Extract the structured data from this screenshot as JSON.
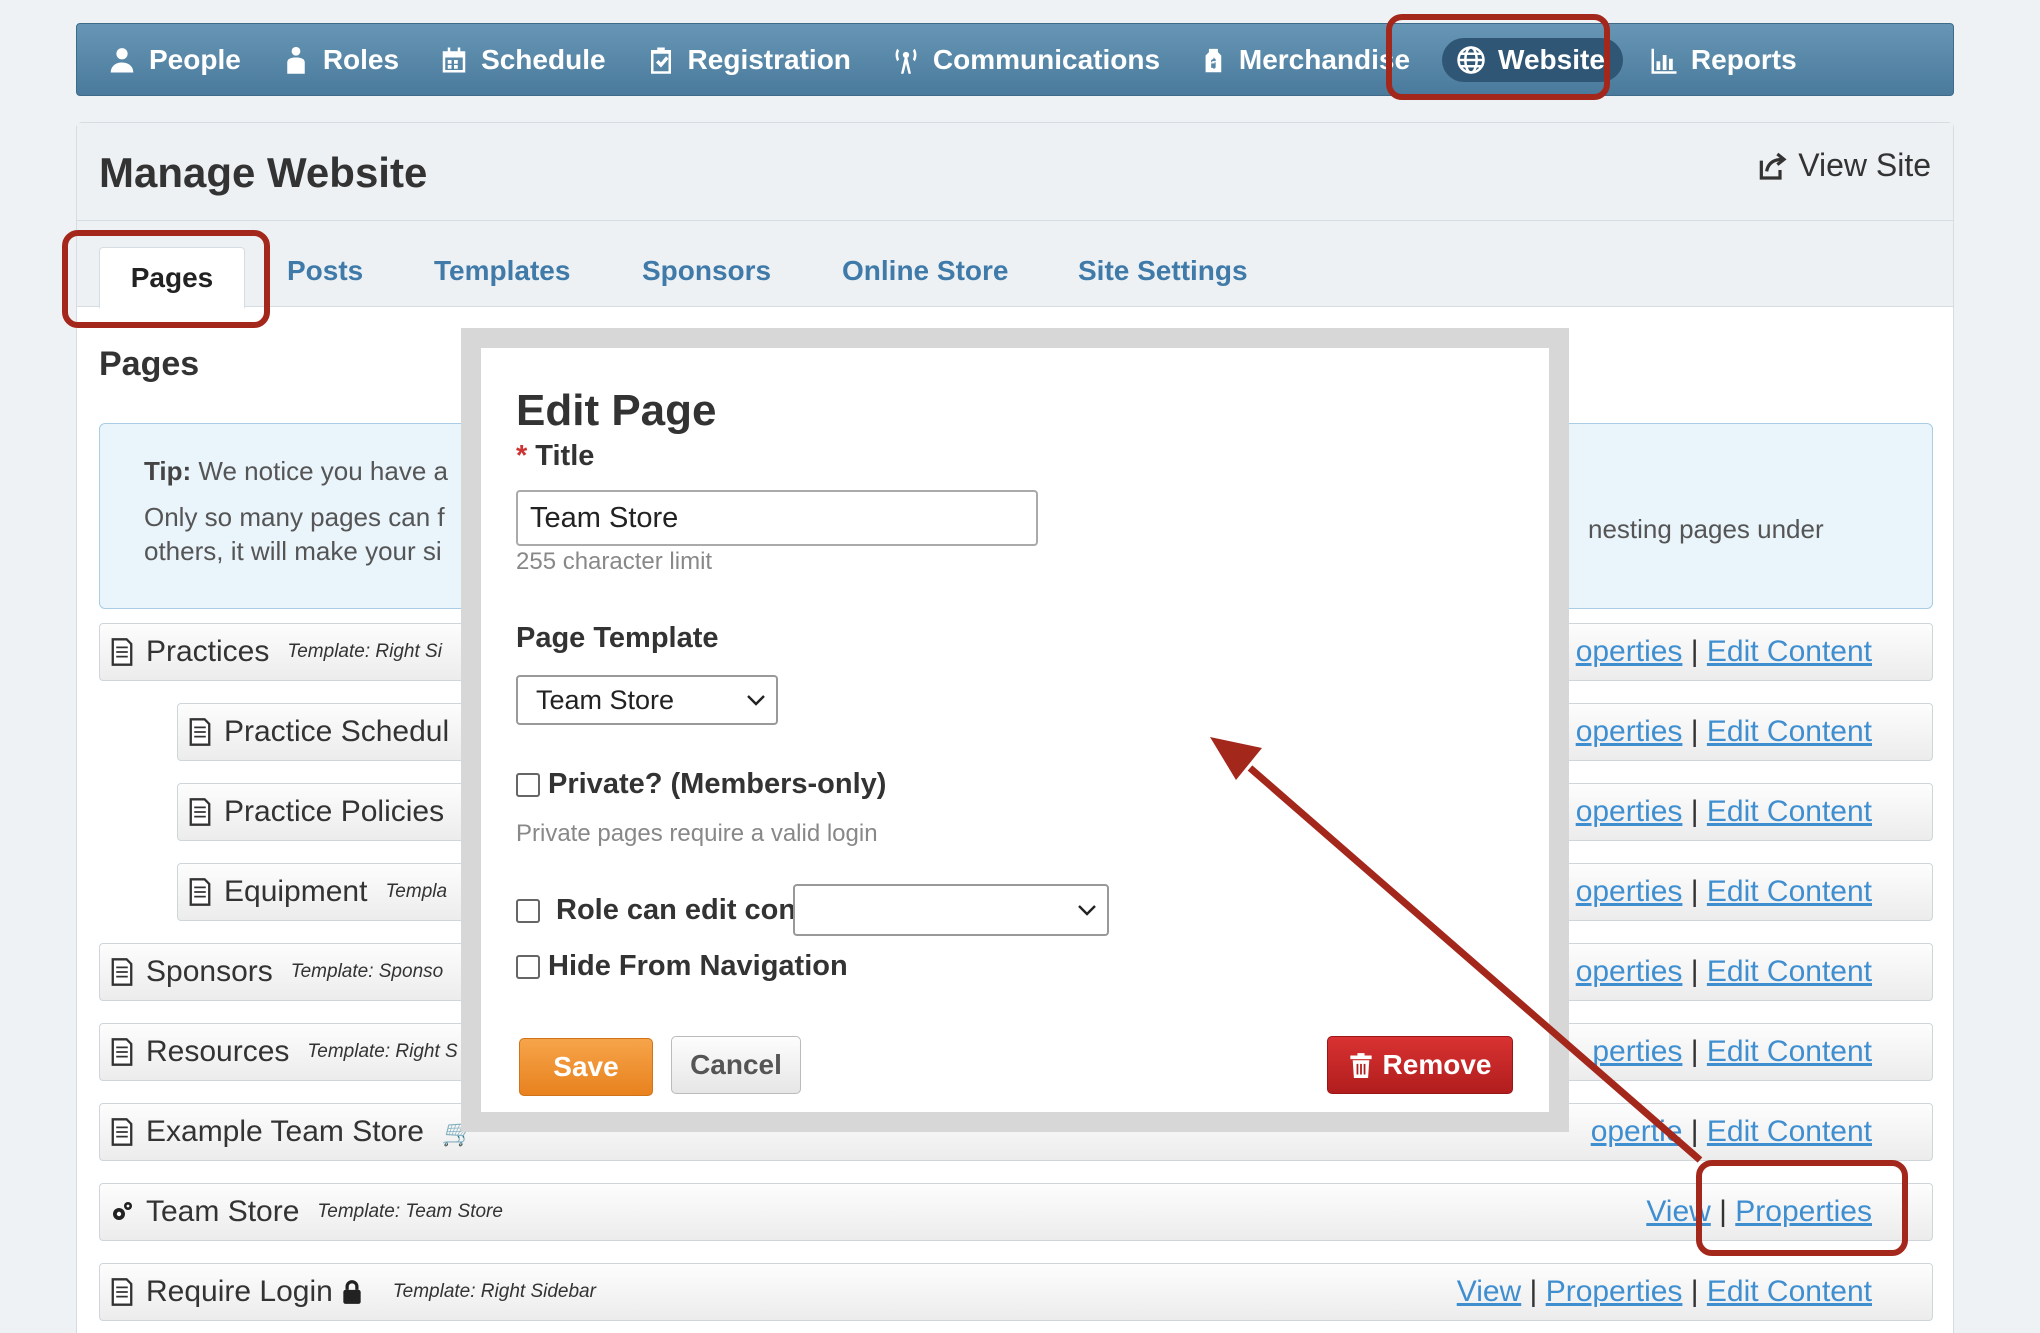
{
  "nav": {
    "items": [
      {
        "label": "People",
        "icon": "people-icon"
      },
      {
        "label": "Roles",
        "icon": "roles-icon"
      },
      {
        "label": "Schedule",
        "icon": "calendar-icon"
      },
      {
        "label": "Registration",
        "icon": "clipboard-check-icon"
      },
      {
        "label": "Communications",
        "icon": "antenna-icon"
      },
      {
        "label": "Merchandise",
        "icon": "price-tag-icon"
      },
      {
        "label": "Website",
        "icon": "globe-icon",
        "active": true
      },
      {
        "label": "Reports",
        "icon": "bar-chart-icon"
      }
    ]
  },
  "header": {
    "title": "Manage Website",
    "view_site": "View Site"
  },
  "tabs": [
    "Pages",
    "Posts",
    "Templates",
    "Sponsors",
    "Online Store",
    "Site Settings"
  ],
  "section_title": "Pages",
  "tip": {
    "label": "Tip:",
    "line1": "We notice you have a",
    "line2": "Only so many pages can f",
    "line2_right": "nesting pages under",
    "line3": "others, it will make your si"
  },
  "rows": [
    {
      "name": "Practices",
      "template": "Template: Right Si",
      "actions": [
        "operties",
        "Edit Content"
      ]
    },
    {
      "name": "Practice Schedul",
      "template": "",
      "actions": [
        "operties",
        "Edit Content"
      ]
    },
    {
      "name": "Practice Policies",
      "template": "",
      "actions": [
        "operties",
        "Edit Content"
      ]
    },
    {
      "name": "Equipment",
      "template": "Templa",
      "actions": [
        "operties",
        "Edit Content"
      ]
    },
    {
      "name": "Sponsors",
      "template": "Template: Sponso",
      "actions": [
        "operties",
        "Edit Content"
      ]
    },
    {
      "name": "Resources",
      "template": "Template: Right S",
      "actions": [
        "perties",
        "Edit Content"
      ]
    },
    {
      "name": "Example Team Store",
      "template": "",
      "actions": [
        "opertie",
        "Edit Content"
      ]
    },
    {
      "name": "Team Store",
      "template": "Template: Team Store",
      "actions": [
        "View",
        "Properties"
      ]
    },
    {
      "name": "Require Login",
      "template": "Template: Right Sidebar",
      "actions": [
        "View",
        "Properties",
        "Edit Content"
      ]
    }
  ],
  "modal": {
    "title": "Edit Page",
    "title_label": "Title",
    "required_mark": "*",
    "title_value": "Team Store",
    "title_hint": "255 character limit",
    "template_label": "Page Template",
    "template_value": "Team Store",
    "private_label": "Private? (Members-only)",
    "private_hint": "Private pages require a valid login",
    "role_label": "Role can edit content",
    "role_value": "",
    "hide_label": "Hide From Navigation",
    "save": "Save",
    "cancel": "Cancel",
    "remove": "Remove"
  },
  "colors": {
    "nav": "#4a7a9c",
    "accent_link": "#3f8ed0",
    "highlight": "#a4271c",
    "save": "#e8821e",
    "remove": "#b11d1d"
  }
}
